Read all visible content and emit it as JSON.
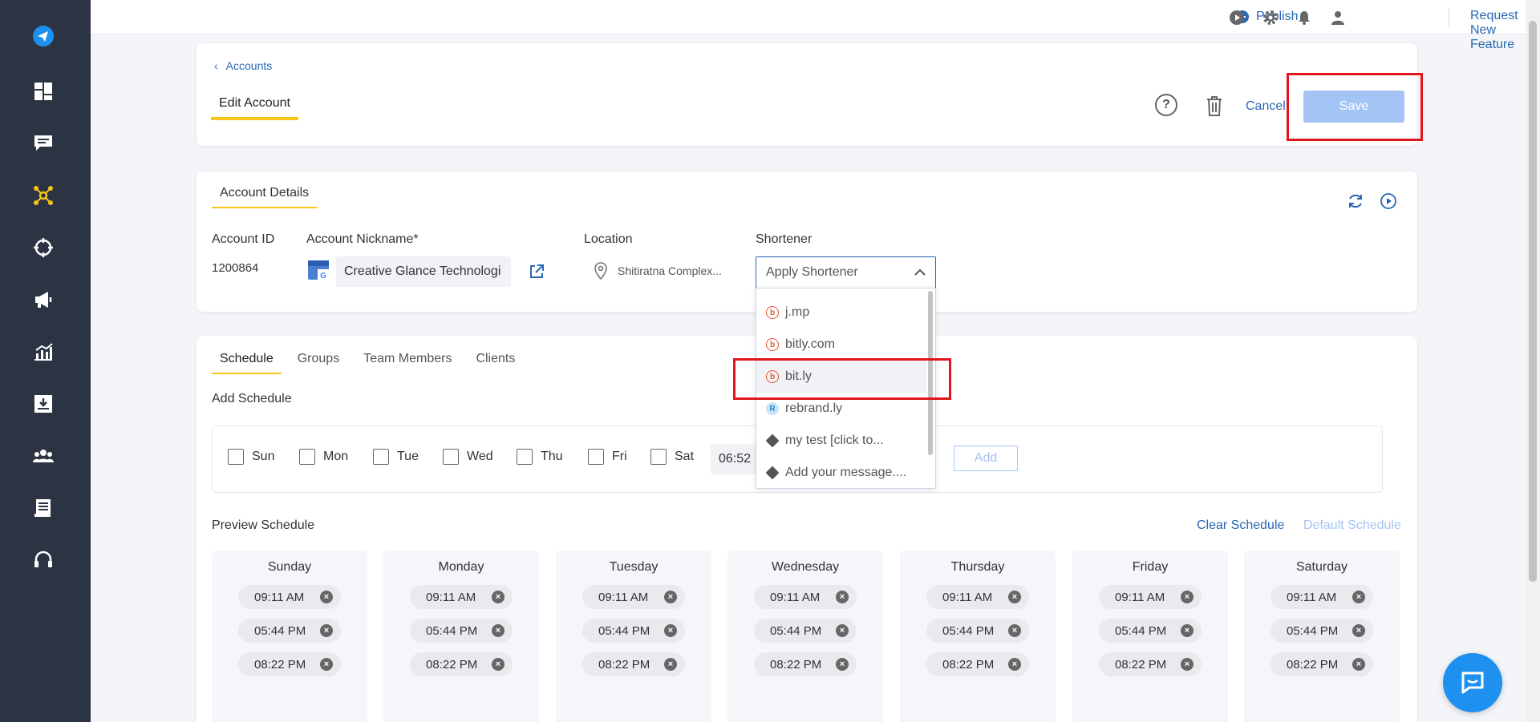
{
  "topbar": {
    "publish_label": "Publish",
    "request_label": "Request New Feature"
  },
  "header": {
    "breadcrumb": "Accounts",
    "title": "Edit Account",
    "cancel_label": "Cancel",
    "save_label": "Save"
  },
  "account": {
    "section_title": "Account Details",
    "id_label": "Account ID",
    "id_value": "1200864",
    "nickname_label": "Account Nickname*",
    "nickname_value": "Creative Glance Technologi",
    "location_label": "Location",
    "location_value": "Shitiratna Complex...",
    "shortener_label": "Shortener",
    "shortener_placeholder": "Apply Shortener"
  },
  "shortener_options": [
    {
      "label": "j.mp",
      "icon": "bitly-icon"
    },
    {
      "label": "bitly.com",
      "icon": "bitly-icon"
    },
    {
      "label": "bit.ly",
      "icon": "bitly-icon"
    },
    {
      "label": "rebrand.ly",
      "icon": "rebrandly-icon"
    },
    {
      "label": "my test [click to...",
      "icon": "tag-icon"
    },
    {
      "label": "Add your message....",
      "icon": "tag-icon"
    }
  ],
  "schedule": {
    "tabs": [
      "Schedule",
      "Groups",
      "Team Members",
      "Clients"
    ],
    "add_label": "Add Schedule",
    "days": [
      "Sun",
      "Mon",
      "Tue",
      "Wed",
      "Thu",
      "Fri",
      "Sat"
    ],
    "time_value": "06:52",
    "add_button": "Add",
    "preview_label": "Preview Schedule",
    "clear_label": "Clear Schedule",
    "default_label": "Default Schedule",
    "columns": [
      {
        "day": "Sunday",
        "times": [
          "09:11 AM",
          "05:44 PM",
          "08:22 PM"
        ]
      },
      {
        "day": "Monday",
        "times": [
          "09:11 AM",
          "05:44 PM",
          "08:22 PM"
        ]
      },
      {
        "day": "Tuesday",
        "times": [
          "09:11 AM",
          "05:44 PM",
          "08:22 PM"
        ]
      },
      {
        "day": "Wednesday",
        "times": [
          "09:11 AM",
          "05:44 PM",
          "08:22 PM"
        ]
      },
      {
        "day": "Thursday",
        "times": [
          "09:11 AM",
          "05:44 PM",
          "08:22 PM"
        ]
      },
      {
        "day": "Friday",
        "times": [
          "09:11 AM",
          "05:44 PM",
          "08:22 PM"
        ]
      },
      {
        "day": "Saturday",
        "times": [
          "09:11 AM",
          "05:44 PM",
          "08:22 PM"
        ]
      }
    ]
  },
  "colors": {
    "sidebar": "#2c3444",
    "accent": "#2867b2",
    "tab_underline": "#f5c518",
    "highlight": "#e0161c",
    "save_disabled": "#a3c4f5"
  }
}
